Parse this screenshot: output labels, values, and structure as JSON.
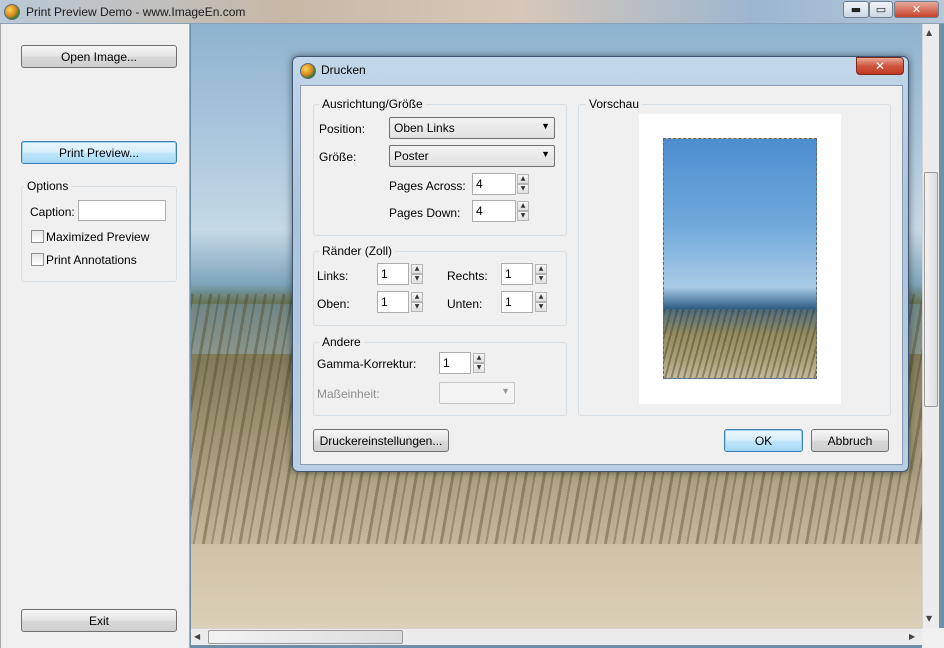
{
  "window": {
    "title": "Print Preview Demo - www.ImageEn.com",
    "min_label": "▬",
    "max_label": "▭",
    "close_label": "✕"
  },
  "left": {
    "open_image": "Open Image...",
    "print_preview": "Print Preview...",
    "options_title": "Options",
    "caption_label": "Caption:",
    "caption_value": "",
    "maximized_preview": "Maximized Preview",
    "print_annotations": "Print Annotations",
    "exit": "Exit"
  },
  "dialog": {
    "title": "Drucken",
    "close_label": "✕",
    "orientation_group": "Ausrichtung/Größe",
    "position_label": "Position:",
    "position_value": "Oben Links",
    "size_label": "Größe:",
    "size_value": "Poster",
    "pages_across_label": "Pages Across:",
    "pages_across_value": "4",
    "pages_down_label": "Pages Down:",
    "pages_down_value": "4",
    "margins_group": "Ränder (Zoll)",
    "left_label": "Links:",
    "left_value": "1",
    "right_label": "Rechts:",
    "right_value": "1",
    "top_label": "Oben:",
    "top_value": "1",
    "bottom_label": "Unten:",
    "bottom_value": "1",
    "other_group": "Andere",
    "gamma_label": "Gamma-Korrektur:",
    "gamma_value": "1",
    "unit_label": "Maßeinheit:",
    "unit_value": "",
    "preview_group": "Vorschau",
    "printer_settings": "Druckereinstellungen...",
    "ok": "OK",
    "cancel": "Abbruch"
  },
  "colors": {
    "focus_border": "#3c7fb1",
    "dialog_frame": "#aac4dd",
    "close_red": "#c23b24"
  }
}
